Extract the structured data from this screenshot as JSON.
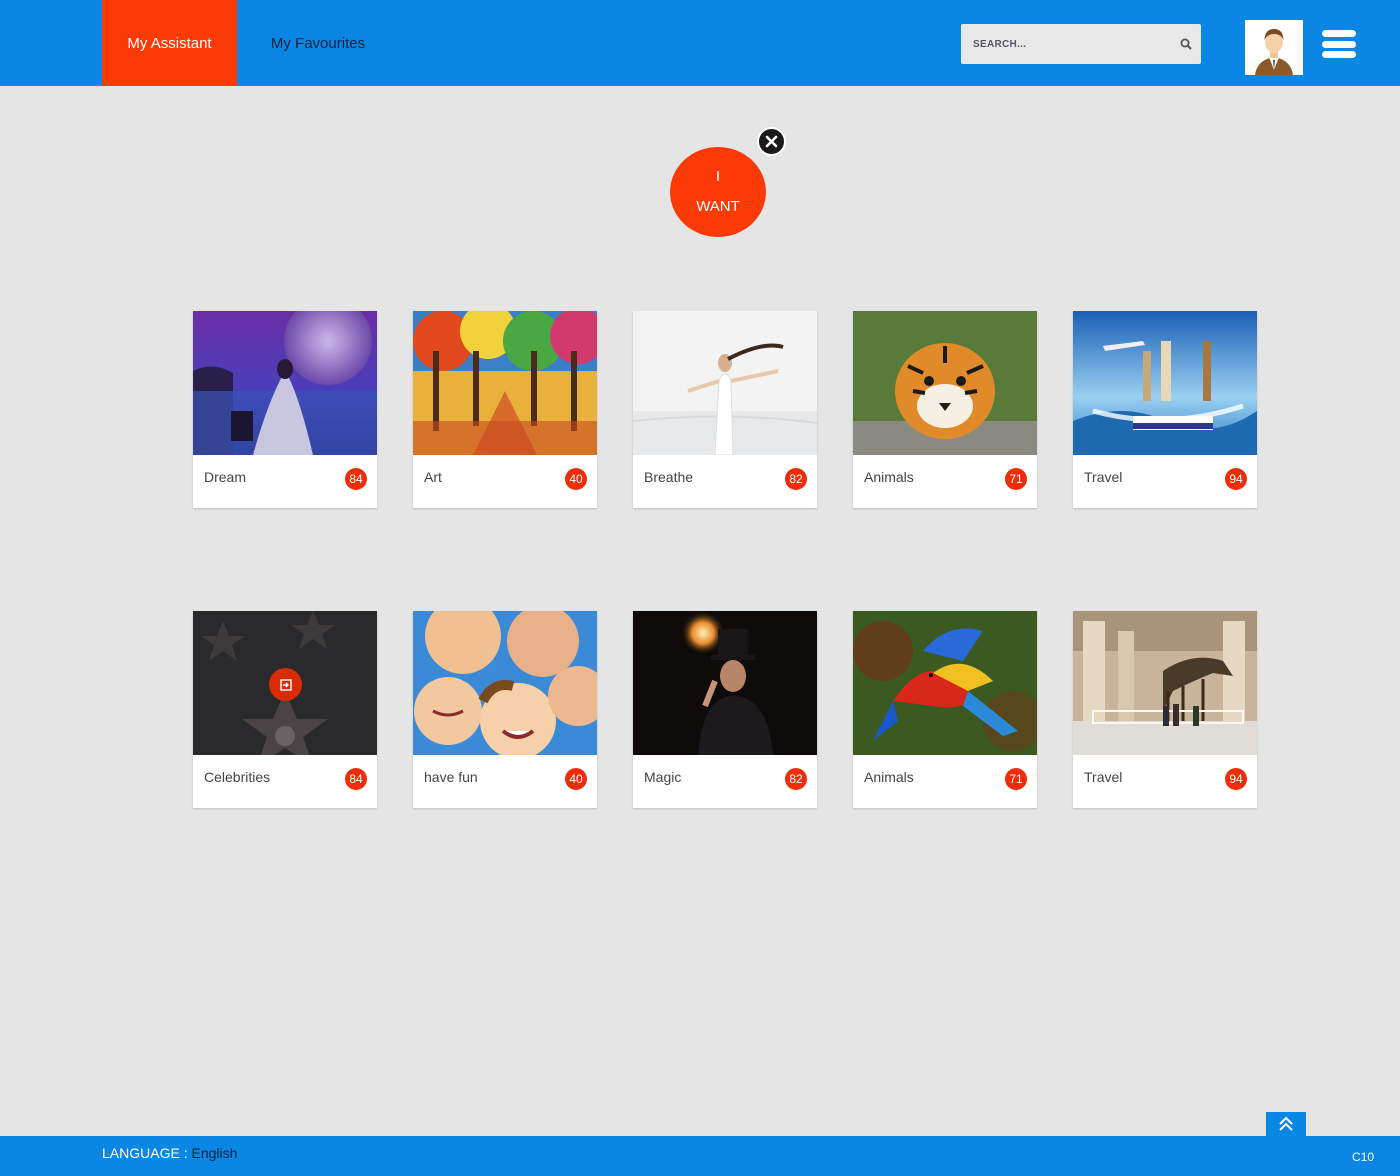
{
  "header": {
    "tabs": [
      {
        "label": "My Assistant",
        "active": true
      },
      {
        "label": "My Favourites",
        "active": false
      }
    ],
    "search": {
      "placeholder": "SEARCH..."
    },
    "avatar_icon": "user-avatar-icon",
    "menu_icon": "hamburger-menu-icon"
  },
  "want": {
    "line1": "I",
    "line2": "WANT",
    "close_icon": "close-icon"
  },
  "cards": [
    {
      "label": "Dream",
      "count": "84"
    },
    {
      "label": "Art",
      "count": "40"
    },
    {
      "label": "Breathe",
      "count": "82"
    },
    {
      "label": "Animals",
      "count": "71"
    },
    {
      "label": "Travel",
      "count": "94"
    },
    {
      "label": "Celebrities",
      "count": "84"
    },
    {
      "label": "have fun",
      "count": "40"
    },
    {
      "label": "Magic",
      "count": "82"
    },
    {
      "label": "Animals",
      "count": "71"
    },
    {
      "label": "Travel",
      "count": "94"
    }
  ],
  "footer": {
    "language_label": "LANGUAGE :",
    "language_value": "English",
    "code": "C10",
    "scroll_top_icon": "double-chevron-up-icon"
  },
  "colors": {
    "primary": "#0a86e4",
    "accent": "#fb3b07",
    "background": "#e5e5e5"
  }
}
